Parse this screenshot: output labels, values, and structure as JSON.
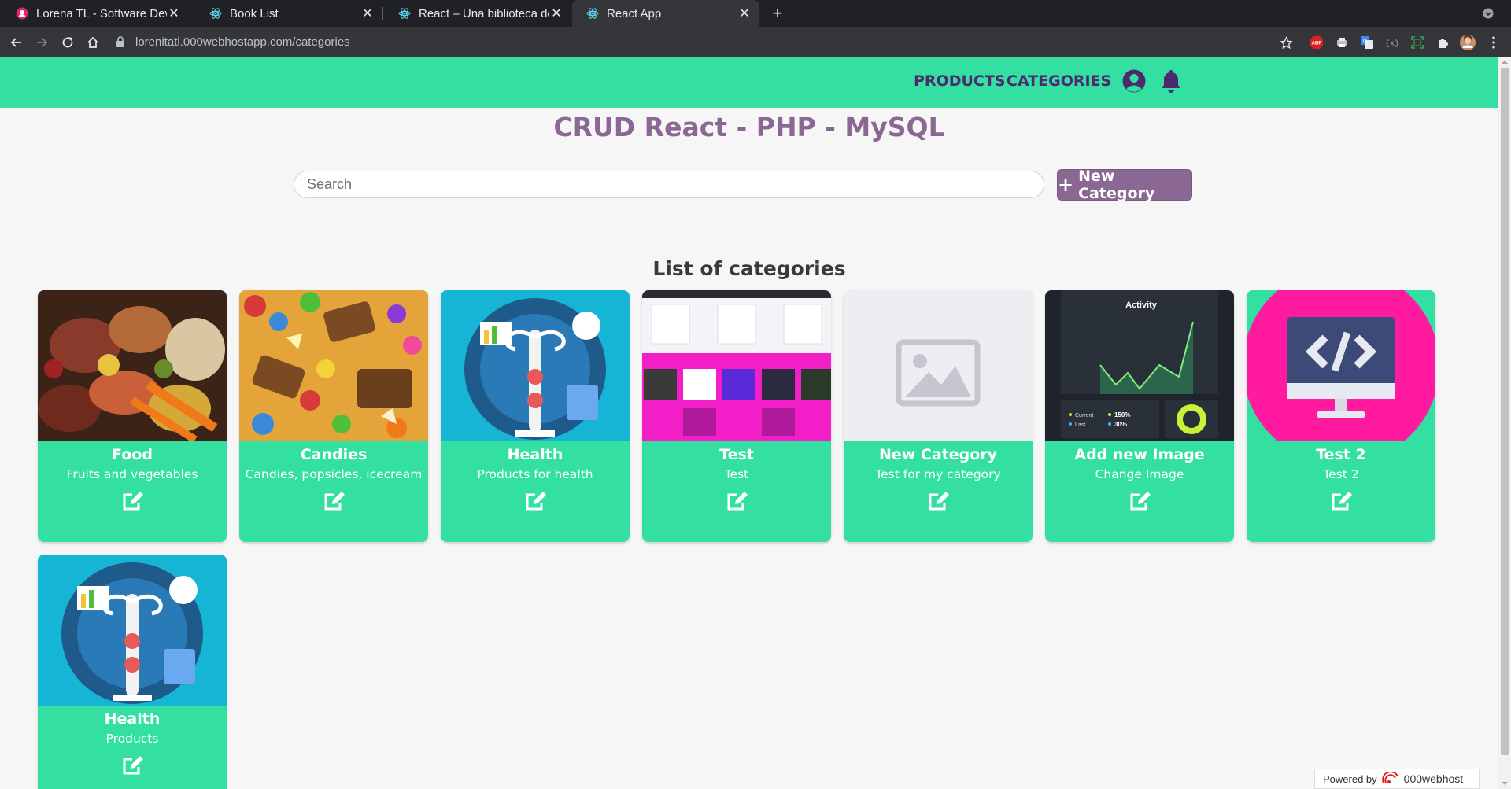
{
  "browser": {
    "tabs": [
      {
        "title": "Lorena TL - Software Deve",
        "favicon": "lorena-favicon",
        "active": false
      },
      {
        "title": "Book List",
        "favicon": "react-favicon",
        "active": false
      },
      {
        "title": "React – Una biblioteca de",
        "favicon": "react-favicon",
        "active": false
      },
      {
        "title": "React App",
        "favicon": "react-favicon",
        "active": true
      }
    ],
    "url": "lorenitatl.000webhostapp.com/categories"
  },
  "app": {
    "nav": {
      "products": "PRODUCTS",
      "categories": "CATEGORIES"
    },
    "title": "CRUD React - PHP - MySQL",
    "search": {
      "placeholder": "Search",
      "value": ""
    },
    "new_category_label": "New Category",
    "list_title": "List of categories",
    "categories": [
      {
        "name": "Food",
        "description": "Fruits and vegetables",
        "image": "food-photo"
      },
      {
        "name": "Candies",
        "description": "Candies, popsicles, icecream",
        "image": "candies-photo"
      },
      {
        "name": "Health",
        "description": "Products for health",
        "image": "health-illustration"
      },
      {
        "name": "Test",
        "description": "Test",
        "image": "app-screenshot"
      },
      {
        "name": "New Category",
        "description": "Test for my category",
        "image": "image-placeholder"
      },
      {
        "name": "Add new Image",
        "description": "Change Image",
        "image": "activity-chart"
      },
      {
        "name": "Test 2",
        "description": "Test 2",
        "image": "code-monitor-icon"
      },
      {
        "name": "Health",
        "description": "Products",
        "image": "health-illustration"
      }
    ]
  },
  "footer": {
    "powered_by": "Powered by",
    "brand": "000webhost"
  },
  "colors": {
    "appbar": "#33e0a1",
    "accent": "#8b6894",
    "nav_link": "#4b2a6e"
  }
}
